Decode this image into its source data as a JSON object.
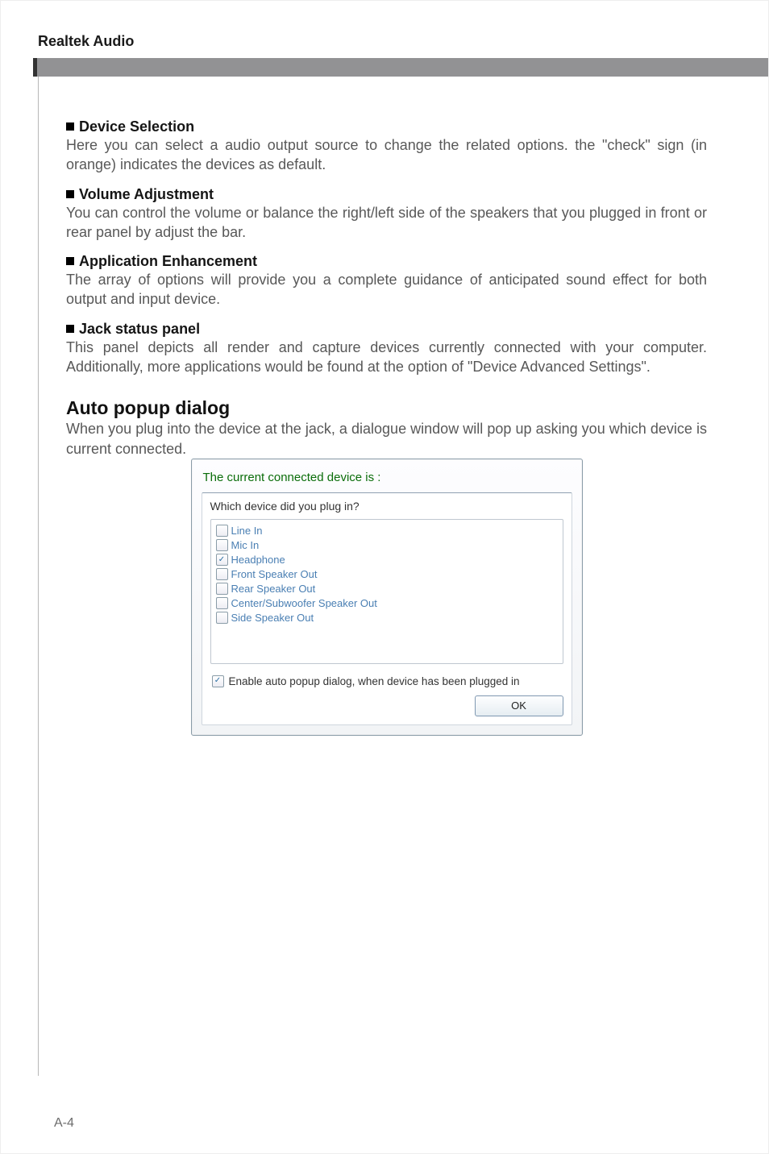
{
  "header": {
    "title": "Realtek Audio"
  },
  "sections": [
    {
      "title": "Device Selection",
      "body": "Here you can select a audio output source to change the related options. the \"check\" sign (in orange) indicates the devices as default."
    },
    {
      "title": "Volume Adjustment",
      "body": "You can control the volume or balance the right/left side of the speakers that you plugged in front or rear panel by adjust the bar."
    },
    {
      "title": "Application Enhancement",
      "body": "The array of options will provide you a complete guidance of anticipated sound effect for both output and input device."
    },
    {
      "title": "Jack status panel",
      "body": "This panel depicts all render and capture devices currently connected with your computer. Additionally, more applications would be found at the option of \"Device Advanced Settings\"."
    }
  ],
  "auto": {
    "heading": "Auto popup dialog",
    "body": "When you plug into the device at the jack, a dialogue window will pop up asking you which device is current connected."
  },
  "dialog": {
    "title": "The current connected device is :",
    "question": "Which device did you plug in?",
    "options": [
      {
        "label": "Line In",
        "checked": false
      },
      {
        "label": "Mic In",
        "checked": false
      },
      {
        "label": "Headphone",
        "checked": true
      },
      {
        "label": "Front Speaker Out",
        "checked": false
      },
      {
        "label": "Rear Speaker Out",
        "checked": false
      },
      {
        "label": "Center/Subwoofer Speaker Out",
        "checked": false
      },
      {
        "label": "Side Speaker Out",
        "checked": false
      }
    ],
    "enable": {
      "label": "Enable auto popup dialog, when device has been plugged in",
      "checked": true
    },
    "ok": "OK"
  },
  "page_number": "A-4",
  "marks": {
    "check": "✓"
  }
}
